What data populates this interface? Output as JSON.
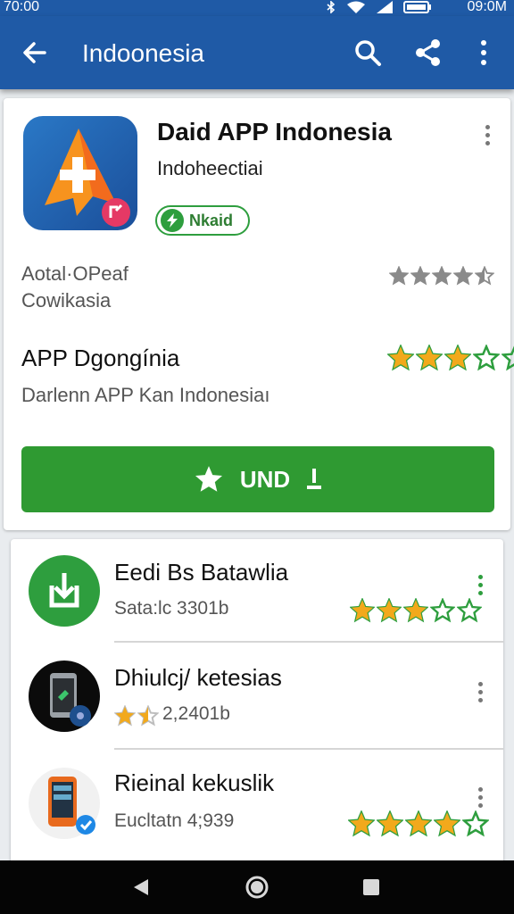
{
  "status_bar": {
    "time_left": "70:00",
    "time_right": "09:0M"
  },
  "app_bar": {
    "title": "Indoonesia",
    "back_icon": "arrow-back-icon",
    "search_icon": "search-icon",
    "share_icon": "share-icon",
    "more_icon": "more-vert-icon"
  },
  "app": {
    "name": "Daid APP Indonesia",
    "developer": "Indoheectiai",
    "badge_label": "Nkaid",
    "meta_line1": "Aotal·OPeaf",
    "meta_line2": "Cowikasia",
    "meta_rating": 4.5,
    "section_title": "APP Dgongínia",
    "section_rating": 3,
    "section_subtitle": "Darlenn APP Kan Indonesiaı",
    "install_label": "UND",
    "install_icon": "star-icon"
  },
  "list": [
    {
      "name": "Eedi Bs Batawlia",
      "sub": "Sata:lc 3301b",
      "rating": 3,
      "icon": "download-app-icon"
    },
    {
      "name": "Dhiulcj/ ketesias",
      "sub": "2,2401b",
      "rating": 1.5,
      "icon": "phone-app-icon"
    },
    {
      "name": "Rieinal kekuslik",
      "sub": "Eucltatn 4;939",
      "rating": 4,
      "icon": "smartphone-app-icon"
    }
  ],
  "colors": {
    "primary": "#1f5aa6",
    "install_green": "#2f9a32",
    "star_gold": "#f2a91c",
    "star_green": "#2e9e3e",
    "star_grey": "#8a8a8a"
  },
  "nav": {
    "back_icon": "nav-back-icon",
    "home_icon": "nav-home-icon",
    "recents_icon": "nav-recents-icon"
  }
}
